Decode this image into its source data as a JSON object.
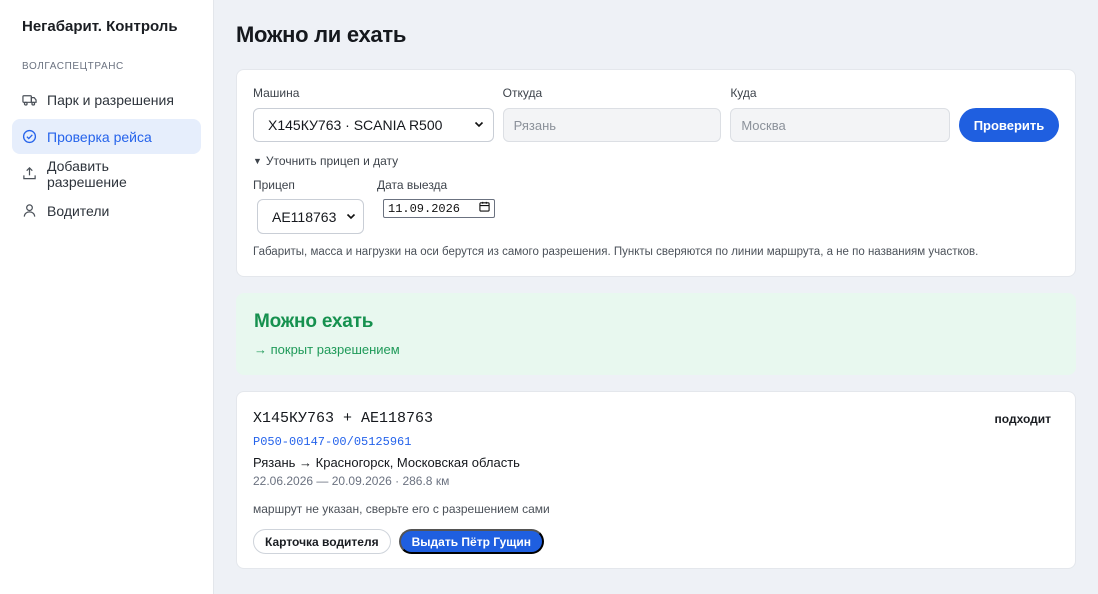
{
  "sidebar": {
    "brand": "Негабарит. Контроль",
    "org": "ВОЛГАСПЕЦТРАНС",
    "items": [
      {
        "label": "Парк и разрешения",
        "icon": "truck-icon",
        "active": false
      },
      {
        "label": "Проверка рейса",
        "icon": "check-circle-icon",
        "active": true
      },
      {
        "label": "Добавить разрешение",
        "icon": "upload-icon",
        "active": false
      },
      {
        "label": "Водители",
        "icon": "user-icon",
        "active": false
      }
    ]
  },
  "page": {
    "title": "Можно ли ехать"
  },
  "form": {
    "vehicle_label": "Машина",
    "vehicle_value": "Х145КУ763 · SCANIA R500",
    "from_label": "Откуда",
    "from_placeholder": "Рязань",
    "to_label": "Куда",
    "to_placeholder": "Москва",
    "check_button": "Проверить",
    "details_toggle": "Уточнить прицеп и дату",
    "trailer_label": "Прицеп",
    "trailer_value": "АЕ118763",
    "date_label": "Дата выезда",
    "date_value": "11.09.2026",
    "hint": "Габариты, масса и нагрузки на оси берутся из самого разрешения. Пункты сверяются по линии маршрута, а не по названиям участков."
  },
  "status": {
    "title": "Можно ехать",
    "subtitle": "→ покрыт разрешением",
    "color": "#16914f"
  },
  "permit": {
    "vehicles": "Х145КУ763 + АЕ118763",
    "badge": "подходит",
    "number": "Р050-00147-00/05125961",
    "route": "Рязань → Красногорск, Московская область",
    "dates": "22.06.2026 — 20.09.2026 · 286.8 км",
    "note": "маршрут не указан, сверьте его с разрешением сами",
    "driver_card_button": "Карточка водителя",
    "issue_button": "Выдать Пётр Гущин"
  },
  "colors": {
    "accent": "#1f5fe0",
    "active_nav_bg": "#e6eefc",
    "success_bg": "#e8f8ef"
  }
}
